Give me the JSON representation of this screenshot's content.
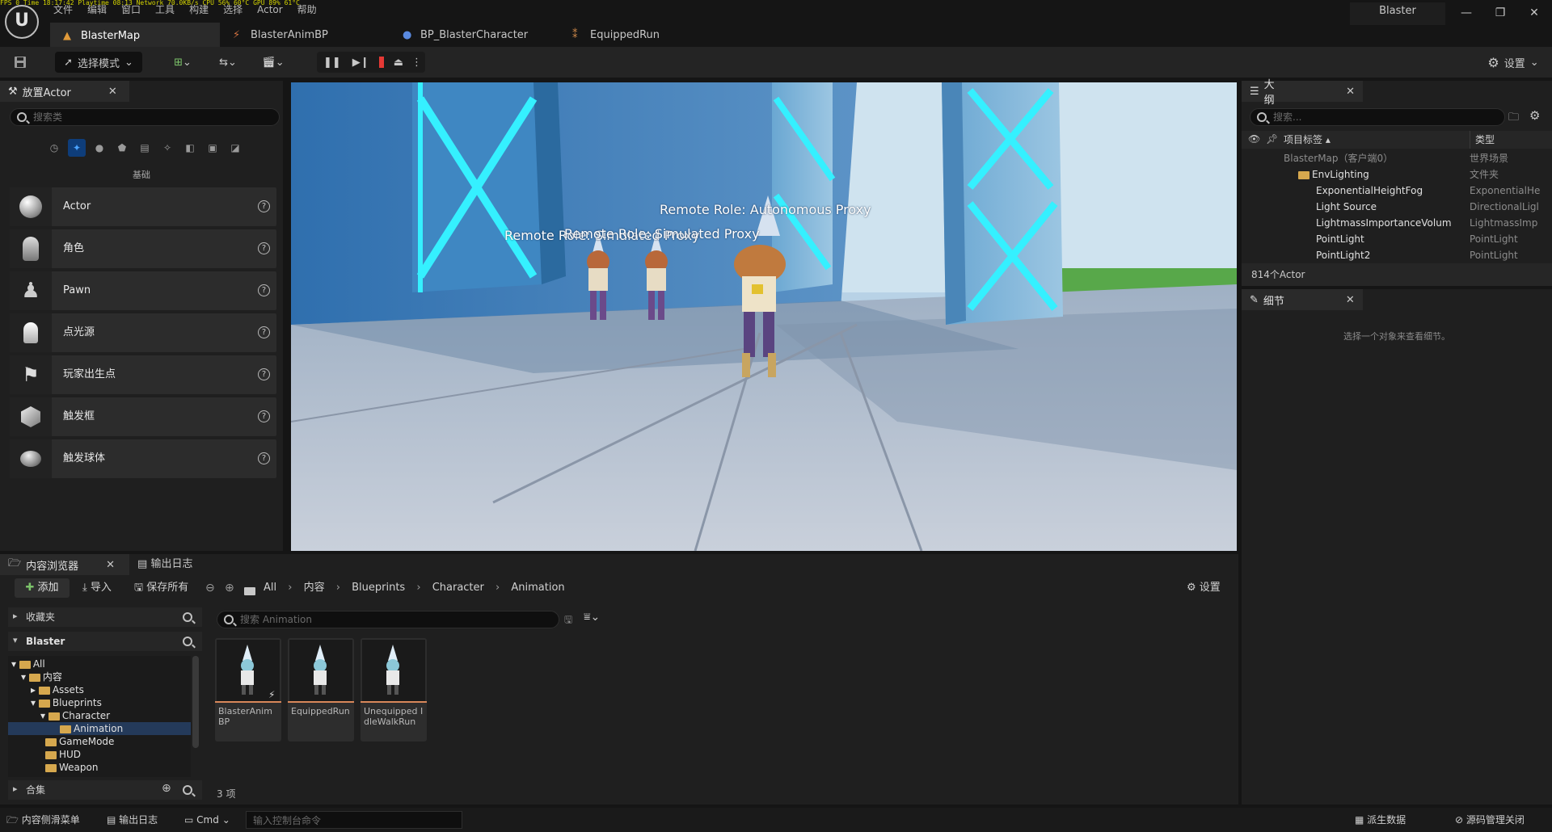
{
  "stats": "FPS 0   Time 18:17:42   Playtime 08:13   Network 70.0KB/s   CPU 56%  60°C   GPU 89%  61°C",
  "menu": [
    "文件",
    "编辑",
    "窗口",
    "工具",
    "构建",
    "选择",
    "Actor",
    "帮助"
  ],
  "project_name": "Blaster",
  "doc_tabs": [
    {
      "label": "BlasterMap"
    },
    {
      "label": "BlasterAnimBP"
    },
    {
      "label": "BP_BlasterCharacter"
    },
    {
      "label": "EquippedRun"
    }
  ],
  "toolbar": {
    "mode_label": "选择模式",
    "settings_label": "设置"
  },
  "place_actor": {
    "tab_label": "放置Actor",
    "search_placeholder": "搜索类",
    "category_label": "基础",
    "items": [
      {
        "label": "Actor"
      },
      {
        "label": "角色"
      },
      {
        "label": "Pawn"
      },
      {
        "label": "点光源"
      },
      {
        "label": "玩家出生点"
      },
      {
        "label": "触发框"
      },
      {
        "label": "触发球体"
      }
    ]
  },
  "viewport": {
    "overlay_1": "Remote Role: Autonomous Proxy",
    "overlay_2": "Remote Role: Simulated Proxy",
    "overlay_3": "Remote Role: Simulated Proxy"
  },
  "outliner": {
    "tab_label": "大纲",
    "search_placeholder": "搜索...",
    "col_label": "项目标签",
    "col_type": "类型",
    "rows": [
      {
        "name": "BlasterMap（客户端0）",
        "type": "世界场景"
      },
      {
        "name": "EnvLighting",
        "type": "文件夹"
      },
      {
        "name": "ExponentialHeightFog",
        "type": "ExponentialHe"
      },
      {
        "name": "Light Source",
        "type": "DirectionalLigl"
      },
      {
        "name": "LightmassImportanceVolum",
        "type": "LightmassImp"
      },
      {
        "name": "PointLight",
        "type": "PointLight"
      },
      {
        "name": "PointLight2",
        "type": "PointLight"
      }
    ],
    "count": "814个Actor"
  },
  "details": {
    "tab_label": "细节",
    "empty_text": "选择一个对象来查看细节。"
  },
  "content_browser": {
    "tab_label": "内容浏览器",
    "output_tab_label": "输出日志",
    "add_label": "添加",
    "import_label": "导入",
    "save_all_label": "保存所有",
    "settings_label": "设置",
    "breadcrumbs": [
      "All",
      "内容",
      "Blueprints",
      "Character",
      "Animation"
    ],
    "favorites_label": "收藏夹",
    "project_label": "Blaster",
    "collections_label": "合集",
    "search_placeholder": "搜索 Animation",
    "tree": [
      "All",
      "内容",
      "Assets",
      "Blueprints",
      "Character",
      "Animation",
      "GameMode",
      "HUD",
      "Weapon"
    ],
    "assets": [
      {
        "name": "BlasterAnim BP"
      },
      {
        "name": "EquippedRun"
      },
      {
        "name": "Unequipped IdleWalkRun"
      }
    ],
    "item_count": "3 项"
  },
  "statusbar": {
    "drawer_label": "内容侧滑菜单",
    "output_label": "输出日志",
    "cmd_label": "Cmd",
    "console_placeholder": "输入控制台命令",
    "derived_label": "派生数据",
    "source_control_label": "源码管理关闭"
  },
  "colors": {
    "accent_blue": "#0e3d7a",
    "stop_red": "#e53935",
    "asset_bar": "#d8875a",
    "folder": "#d6a84e"
  }
}
